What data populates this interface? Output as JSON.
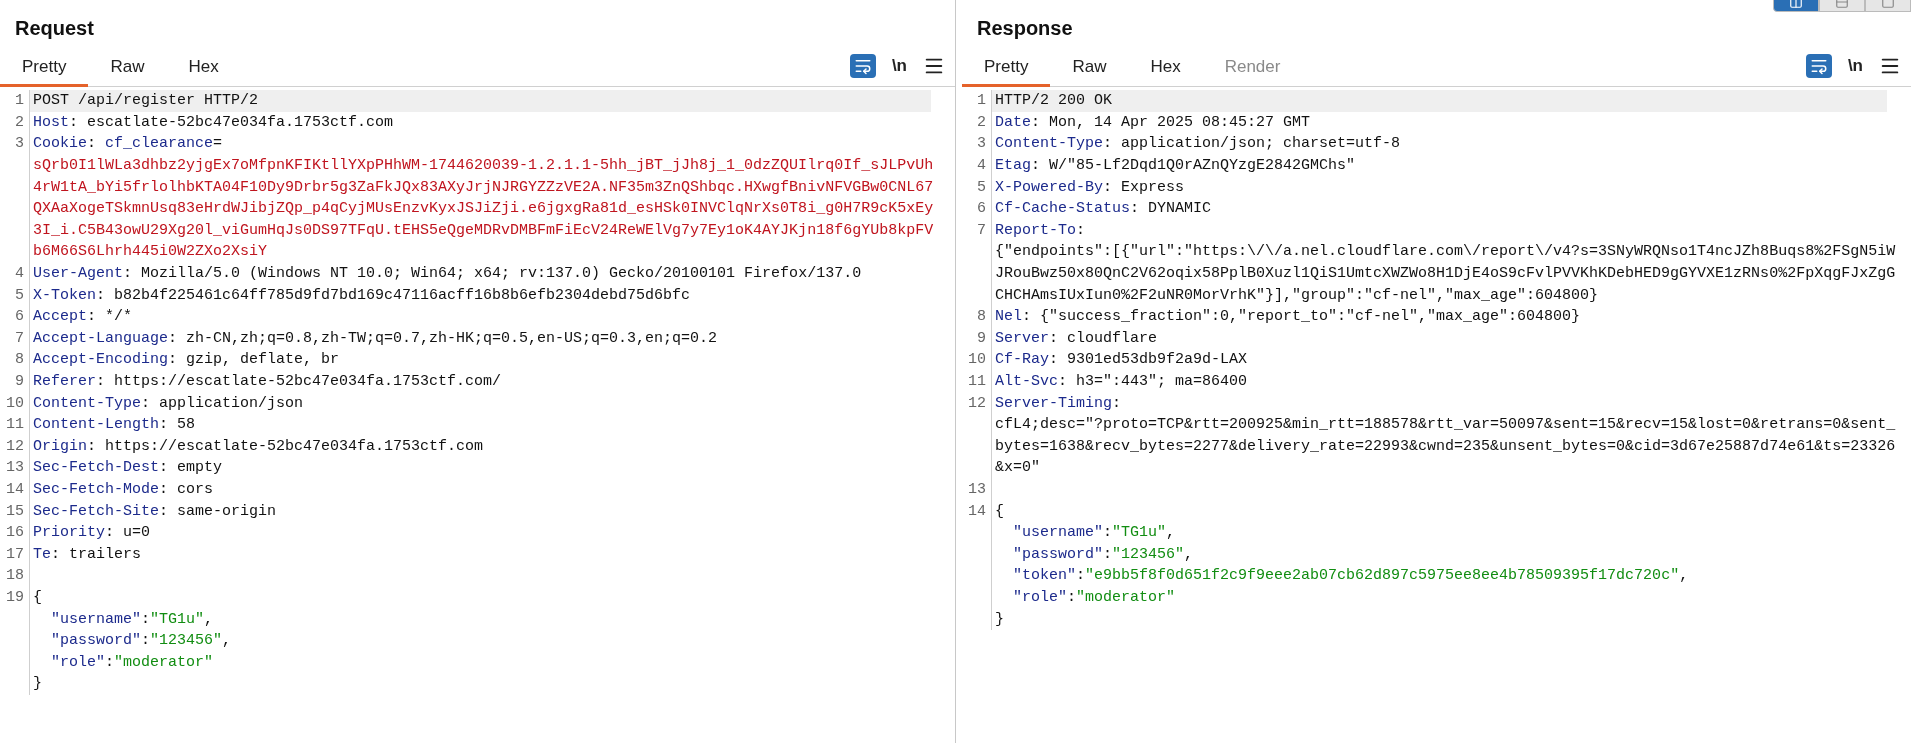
{
  "layout_buttons": [
    {
      "selected": true
    },
    {
      "selected": false
    },
    {
      "selected": false
    }
  ],
  "panes": [
    {
      "title": "Request",
      "wrap_on": true,
      "newline_toggle": "\\n",
      "tabs": [
        {
          "label": "Pretty",
          "selected": true,
          "disabled": false
        },
        {
          "label": "Raw",
          "selected": false,
          "disabled": false
        },
        {
          "label": "Hex",
          "selected": false,
          "disabled": false
        }
      ],
      "lines": [
        {
          "number": "1",
          "kind": "plain",
          "highlighted": true,
          "text": "POST /api/register HTTP/2"
        },
        {
          "number": "2",
          "kind": "header",
          "highlighted": false,
          "name": "Host",
          "value": ": escatlate-52bc47e034fa.1753ctf.com"
        },
        {
          "number": "3",
          "kind": "cookie",
          "highlighted": false,
          "name": "Cookie",
          "value": ": ",
          "cookie_name": "cf_clearance",
          "eq": "=",
          "wrap": [
            "sQrb0I1lWLa3dhbz2yjgEx7oMfpnKFIKtllYXpPHhWM-1744620039-1.2.1.1-5hh_jBT_jJh8j_1_0dzZQUIlrq0If_sJLPvUh",
            "4rW1tA_bYi5frlolhbKTA04F10Dy9Drbr5g3ZaFkJQx83AXyJrjNJRGYZZzVE2A.NF35m3ZnQShbqc.HXwgfBnivNFVGBw0CNL67",
            "QXAaXogeTSkmnUsq83eHrdWJibjZQp_p4qCyjMUsEnzvKyxJSJiZji.e6jgxgRa81d_esHSk0INVClqNrXs0T8i_g0H7R9cK5xEy",
            "3I_i.C5B43owU29Xg20l_viGumHqJs0DS97TFqU.tEHS5eQgeMDRvDMBFmFiEcV24ReWElVg7y7Ey1oK4AYJKjn18f6gYUb8kpFV",
            "b6M66S6Lhrh445i0W2ZXo2XsiY"
          ]
        },
        {
          "number": "4",
          "kind": "header",
          "highlighted": false,
          "name": "User-Agent",
          "value": ": Mozilla/5.0 (Windows NT 10.0; Win64; x64; rv:137.0) Gecko/20100101 Firefox/137.0"
        },
        {
          "number": "5",
          "kind": "header",
          "highlighted": false,
          "name": "X-Token",
          "value": ": b82b4f225461c64ff785d9fd7bd169c47116acff16b8b6efb2304debd75d6bfc"
        },
        {
          "number": "6",
          "kind": "header",
          "highlighted": false,
          "name": "Accept",
          "value": ": */*"
        },
        {
          "number": "7",
          "kind": "header",
          "highlighted": false,
          "name": "Accept-Language",
          "value": ": zh-CN,zh;q=0.8,zh-TW;q=0.7,zh-HK;q=0.5,en-US;q=0.3,en;q=0.2"
        },
        {
          "number": "8",
          "kind": "header",
          "highlighted": false,
          "name": "Accept-Encoding",
          "value": ": gzip, deflate, br"
        },
        {
          "number": "9",
          "kind": "header",
          "highlighted": false,
          "name": "Referer",
          "value": ": https://escatlate-52bc47e034fa.1753ctf.com/"
        },
        {
          "number": "10",
          "kind": "header",
          "highlighted": false,
          "name": "Content-Type",
          "value": ": application/json"
        },
        {
          "number": "11",
          "kind": "header",
          "highlighted": false,
          "name": "Content-Length",
          "value": ": 58"
        },
        {
          "number": "12",
          "kind": "header",
          "highlighted": false,
          "name": "Origin",
          "value": ": https://escatlate-52bc47e034fa.1753ctf.com"
        },
        {
          "number": "13",
          "kind": "header",
          "highlighted": false,
          "name": "Sec-Fetch-Dest",
          "value": ": empty"
        },
        {
          "number": "14",
          "kind": "header",
          "highlighted": false,
          "name": "Sec-Fetch-Mode",
          "value": ": cors"
        },
        {
          "number": "15",
          "kind": "header",
          "highlighted": false,
          "name": "Sec-Fetch-Site",
          "value": ": same-origin"
        },
        {
          "number": "16",
          "kind": "header",
          "highlighted": false,
          "name": "Priority",
          "value": ": u=0"
        },
        {
          "number": "17",
          "kind": "header",
          "highlighted": false,
          "name": "Te",
          "value": ": trailers"
        },
        {
          "number": "18",
          "kind": "blank",
          "highlighted": false
        },
        {
          "number": "19",
          "kind": "json",
          "highlighted": false,
          "open": "{",
          "close": "}",
          "entries": [
            {
              "key": "\"username\"",
              "sep": ":",
              "value": "\"TG1u\"",
              "comma": ","
            },
            {
              "key": "\"password\"",
              "sep": ":",
              "value": "\"123456\"",
              "comma": ","
            },
            {
              "key": "\"role\"",
              "sep": ":",
              "value": "\"moderator\""
            }
          ]
        }
      ]
    },
    {
      "title": "Response",
      "wrap_on": true,
      "newline_toggle": "\\n",
      "tabs": [
        {
          "label": "Pretty",
          "selected": true,
          "disabled": false
        },
        {
          "label": "Raw",
          "selected": false,
          "disabled": false
        },
        {
          "label": "Hex",
          "selected": false,
          "disabled": false
        },
        {
          "label": "Render",
          "selected": false,
          "disabled": true
        }
      ],
      "lines": [
        {
          "number": "1",
          "kind": "plain",
          "highlighted": true,
          "text": "HTTP/2 200 OK"
        },
        {
          "number": "2",
          "kind": "header",
          "highlighted": false,
          "name": "Date",
          "value": ": Mon, 14 Apr 2025 08:45:27 GMT"
        },
        {
          "number": "3",
          "kind": "header",
          "highlighted": false,
          "name": "Content-Type",
          "value": ": application/json; charset=utf-8"
        },
        {
          "number": "4",
          "kind": "header",
          "highlighted": false,
          "name": "Etag",
          "value": ": W/\"85-Lf2Dqd1Q0rAZnQYzgE2842GMChs\""
        },
        {
          "number": "5",
          "kind": "header",
          "highlighted": false,
          "name": "X-Powered-By",
          "value": ": Express"
        },
        {
          "number": "6",
          "kind": "header",
          "highlighted": false,
          "name": "Cf-Cache-Status",
          "value": ": DYNAMIC"
        },
        {
          "number": "7",
          "kind": "header",
          "highlighted": false,
          "name": "Report-To",
          "value": ":",
          "wrap": [
            "{\"endpoints\":[{\"url\":\"https:\\/\\/a.nel.cloudflare.com\\/report\\/v4?s=3SNyWRQNso1T4ncJZh8Buqs8%2FSgN5iW",
            "JRouBwz50x80QnC2V62oqix58PplB0Xuzl1QiS1UmtcXWZWo8H1DjE4oS9cFvlPVVKhKDebHED9gGYVXE1zRNs0%2FpXqgFJxZgG",
            "CHCHAmsIUxIun0%2F2uNR0MorVrhK\"}],\"group\":\"cf-nel\",\"max_age\":604800}"
          ]
        },
        {
          "number": "8",
          "kind": "header",
          "highlighted": false,
          "name": "Nel",
          "value": ": {\"success_fraction\":0,\"report_to\":\"cf-nel\",\"max_age\":604800}"
        },
        {
          "number": "9",
          "kind": "header",
          "highlighted": false,
          "name": "Server",
          "value": ": cloudflare"
        },
        {
          "number": "10",
          "kind": "header",
          "highlighted": false,
          "name": "Cf-Ray",
          "value": ": 9301ed53db9f2a9d-LAX"
        },
        {
          "number": "11",
          "kind": "header",
          "highlighted": false,
          "name": "Alt-Svc",
          "value": ": h3=\":443\"; ma=86400"
        },
        {
          "number": "12",
          "kind": "header",
          "highlighted": false,
          "name": "Server-Timing",
          "value": ":",
          "wrap": [
            "cfL4;desc=\"?proto=TCP&rtt=200925&min_rtt=188578&rtt_var=50097&sent=15&recv=15&lost=0&retrans=0&sent_",
            "bytes=1638&recv_bytes=2277&delivery_rate=22993&cwnd=235&unsent_bytes=0&cid=3d67e25887d74e61&ts=23326",
            "&x=0\""
          ]
        },
        {
          "number": "13",
          "kind": "blank",
          "highlighted": false
        },
        {
          "number": "14",
          "kind": "json",
          "highlighted": false,
          "open": "{",
          "close": "}",
          "entries": [
            {
              "key": "\"username\"",
              "sep": ":",
              "value": "\"TG1u\"",
              "comma": ","
            },
            {
              "key": "\"password\"",
              "sep": ":",
              "value": "\"123456\"",
              "comma": ","
            },
            {
              "key": "\"token\"",
              "sep": ":",
              "value": "\"e9bb5f8f0d651f2c9f9eee2ab07cb62d897c5975ee8ee4b78509395f17dc720c\"",
              "comma": ","
            },
            {
              "key": "\"role\"",
              "sep": ":",
              "value": "\"moderator\""
            }
          ]
        }
      ]
    }
  ]
}
